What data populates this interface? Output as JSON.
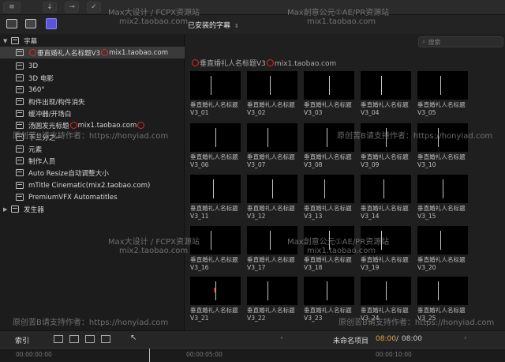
{
  "toolbar": {
    "icons": [
      "library-icon",
      "photos-icon",
      "titles-icon"
    ]
  },
  "browser": {
    "filter_label": "已安装的字幕",
    "search_placeholder": "搜索",
    "group_title_a": "垂直婚礼人名标题V3",
    "group_title_b": "mix1.taobao.com"
  },
  "sidebar": {
    "items": [
      {
        "label": "字幕",
        "level": 0
      },
      {
        "label": "垂直婚礼人名标题V3",
        "suffix": "mix1.taobao.com",
        "level": 1
      },
      {
        "label": "3D",
        "level": 1
      },
      {
        "label": "3D 电影",
        "level": 1
      },
      {
        "label": "360°",
        "level": 1
      },
      {
        "label": "构件出现/构件消失",
        "level": 1
      },
      {
        "label": "缓冲器/开场白",
        "level": 1
      },
      {
        "label": "汤圆发光标题",
        "suffix": "mix1.taobao.com",
        "level": 1
      },
      {
        "label": "下三分之一",
        "level": 1
      },
      {
        "label": "元素",
        "level": 1
      },
      {
        "label": "制作人员",
        "level": 1
      },
      {
        "label": "Auto Resize自动调整大小",
        "level": 1
      },
      {
        "label": "mTitle Cinematic(mix2.taobao.com)",
        "level": 1
      },
      {
        "label": "PremiumVFX Automatitles",
        "level": 1
      },
      {
        "label": "发生器",
        "level": 0
      }
    ]
  },
  "titles": [
    [
      "垂直婚礼人名标题",
      "V3_01"
    ],
    [
      "垂直婚礼人名标题",
      "V3_02"
    ],
    [
      "垂直婚礼人名标题",
      "V3_03"
    ],
    [
      "垂直婚礼人名标题",
      "V3_04"
    ],
    [
      "垂直婚礼人名标题",
      "V3_05"
    ],
    [
      "垂直婚礼人名标题",
      "V3_06"
    ],
    [
      "垂直婚礼人名标题",
      "V3_07"
    ],
    [
      "垂直婚礼人名标题",
      "V3_08"
    ],
    [
      "垂直婚礼人名标题",
      "V3_09"
    ],
    [
      "垂直婚礼人名标题",
      "V3_10"
    ],
    [
      "垂直婚礼人名标题",
      "V3_11"
    ],
    [
      "垂直婚礼人名标题",
      "V3_12"
    ],
    [
      "垂直婚礼人名标题",
      "V3_13"
    ],
    [
      "垂直婚礼人名标题",
      "V3_14"
    ],
    [
      "垂直婚礼人名标题",
      "V3_15"
    ],
    [
      "垂直婚礼人名标题",
      "V3_16"
    ],
    [
      "垂直婚礼人名标题",
      "V3_17"
    ],
    [
      "垂直婚礼人名标题",
      "V3_18"
    ],
    [
      "垂直婚礼人名标题",
      "V3_19"
    ],
    [
      "垂直婚礼人名标题",
      "V3_20"
    ],
    [
      "垂直婚礼人名标题",
      "V3_21"
    ],
    [
      "垂直婚礼人名标题",
      "V3_22"
    ],
    [
      "垂直婚礼人名标题",
      "V3_23"
    ],
    [
      "垂直婚礼人名标题",
      "V3_24"
    ],
    [
      "垂直婚礼人名标题",
      "V3_25"
    ]
  ],
  "bottom": {
    "index_label": "索引",
    "project_name": "未命名项目",
    "time_current": "08:00",
    "time_sep": "/",
    "time_total": "08:00"
  },
  "timeline": {
    "ticks": [
      "00:00:00:00",
      "00:00:05:00",
      "00:00:10:00"
    ]
  },
  "watermarks": [
    {
      "text": "Max大设计 / FCPX资源站"
    },
    {
      "text": "mix2.taobao.com"
    },
    {
      "text": "Max創意公元①AE/PR资源站"
    },
    {
      "text": "mix1.taobao.com"
    },
    {
      "text": "原创苦B请支持作者：https://honyiad.com"
    },
    {
      "text": "原创苦B请支持作者：https://honyiad.com"
    },
    {
      "text": "Max大设计 / FCPX资源站"
    },
    {
      "text": "mix2.taobao.com"
    },
    {
      "text": "Max創意公元①AE/PR资源站"
    },
    {
      "text": "mix1.taobao.com"
    },
    {
      "text": "原创苦B请支持作者：https://honyiad.com"
    },
    {
      "text": "原创苦B请支持作者：https://honyiad.com"
    }
  ],
  "colors": {
    "accent": "#e8a33b",
    "highlight_ring": "#e2262b",
    "selected_row": "#3a3a3a"
  }
}
